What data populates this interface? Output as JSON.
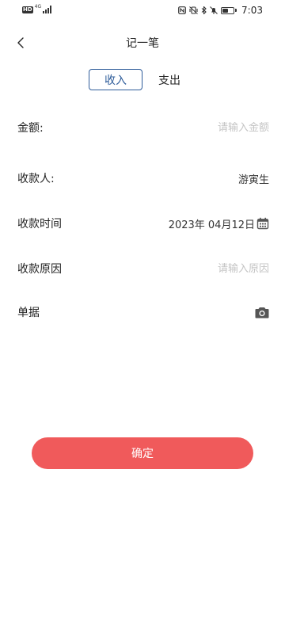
{
  "status_bar": {
    "hd": "HD",
    "network": "4G",
    "time": "7:03",
    "battery_level": 0.5
  },
  "header": {
    "title": "记一笔",
    "back_icon": "chevron-left-icon"
  },
  "tabs": [
    {
      "label": "收入",
      "selected": true
    },
    {
      "label": "支出",
      "selected": false
    }
  ],
  "form": {
    "amount": {
      "label": "金额:",
      "placeholder": "请输入金额"
    },
    "payee": {
      "label": "收款人:",
      "value": "游寅生"
    },
    "date": {
      "label": "收款时间",
      "value": "2023年 04月12日",
      "icon": "calendar-icon"
    },
    "reason": {
      "label": "收款原因",
      "placeholder": "请输入原因"
    },
    "receipt": {
      "label": "单据",
      "icon": "camera-icon"
    }
  },
  "confirm_button": {
    "label": "确定"
  },
  "colors": {
    "accent": "#2e5c9a",
    "confirm": "#f05a5b",
    "placeholder": "#c4c4c4"
  }
}
